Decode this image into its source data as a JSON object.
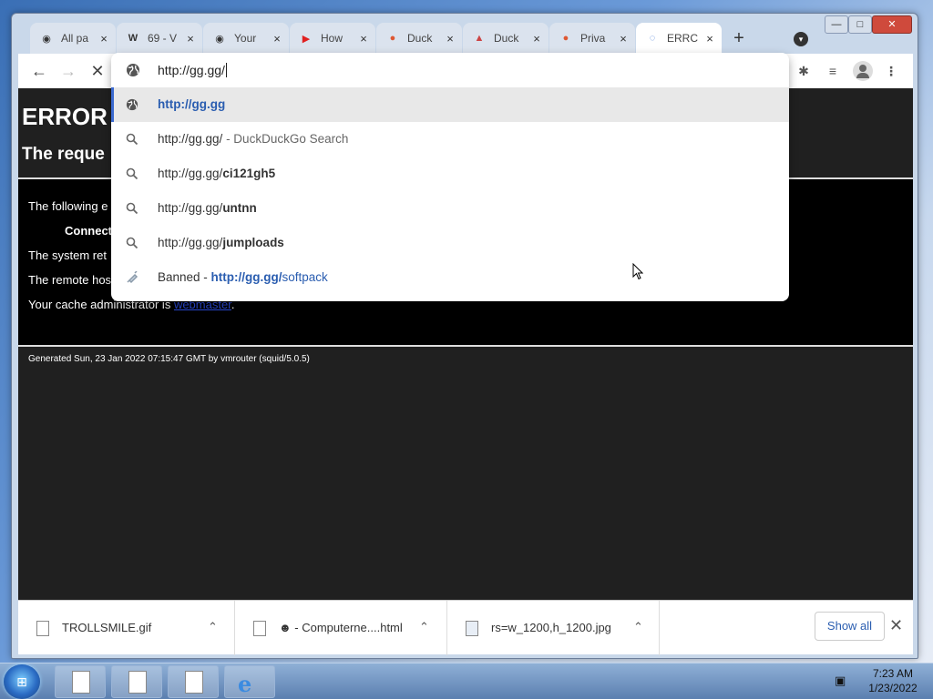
{
  "tabs": [
    {
      "title": "All pa",
      "icon": "github-icon",
      "fav": "◉"
    },
    {
      "title": "69 - V",
      "icon": "wikipedia-icon",
      "fav": "W"
    },
    {
      "title": "Your",
      "icon": "github-icon",
      "fav": "◉"
    },
    {
      "title": "How",
      "icon": "youtube-icon",
      "fav": "▶"
    },
    {
      "title": "Duck",
      "icon": "duckduckgo-icon",
      "fav": "●"
    },
    {
      "title": "Duck",
      "icon": "image-icon",
      "fav": "▲"
    },
    {
      "title": "Priva",
      "icon": "duckduckgo-icon",
      "fav": "●"
    },
    {
      "title": "ERRC",
      "icon": "loading-spinner-icon",
      "fav": "◌"
    }
  ],
  "tab_close": "×",
  "new_tab": "+",
  "window_controls": {
    "minimize": "—",
    "maximize": "□",
    "close": "✕"
  },
  "toolbar": {
    "back": "←",
    "forward": "→",
    "stop": "✕"
  },
  "omnibox": {
    "value": "http://gg.gg/",
    "suggestions": [
      {
        "type": "url",
        "pre": "",
        "bold": "http://gg.gg",
        "post": "",
        "icon": "globe-icon"
      },
      {
        "type": "search",
        "pre": "http://gg.gg/",
        "bold": "",
        "post": " - DuckDuckGo Search",
        "icon": "search-icon"
      },
      {
        "type": "search",
        "pre": "http://gg.gg/",
        "bold": "ci121gh5",
        "post": "",
        "icon": "search-icon"
      },
      {
        "type": "search",
        "pre": "http://gg.gg/",
        "bold": "untnn",
        "post": "",
        "icon": "search-icon"
      },
      {
        "type": "search",
        "pre": "http://gg.gg/",
        "bold": "jumploads",
        "post": "",
        "icon": "search-icon"
      },
      {
        "type": "bookmark",
        "pre": "Banned - ",
        "bold": "http://gg.gg/",
        "post": "softpack",
        "icon": "syringe-icon"
      }
    ]
  },
  "page": {
    "error_title": "ERROR",
    "error_subtitle": "The reque",
    "line1": "The following e",
    "bold_line": "Connect",
    "line2": "The system ret",
    "line3": "The remote hos",
    "line4_pre": "Your cache administrator is ",
    "line4_link": "webmaster",
    "line4_post": ".",
    "footer": "Generated Sun, 23 Jan 2022 07:15:47 GMT by vmrouter (squid/5.0.5)"
  },
  "downloads": {
    "items": [
      {
        "name": "TROLLSMILE.gif",
        "icon": "file-icon"
      },
      {
        "name": "☻ - Computerne....html",
        "icon": "file-icon"
      },
      {
        "name": "rs=w_1200,h_1200.jpg",
        "icon": "image-file-icon"
      }
    ],
    "show_all": "Show all",
    "close": "✕"
  },
  "taskbar": {
    "time": "7:23 AM",
    "date": "1/23/2022"
  }
}
